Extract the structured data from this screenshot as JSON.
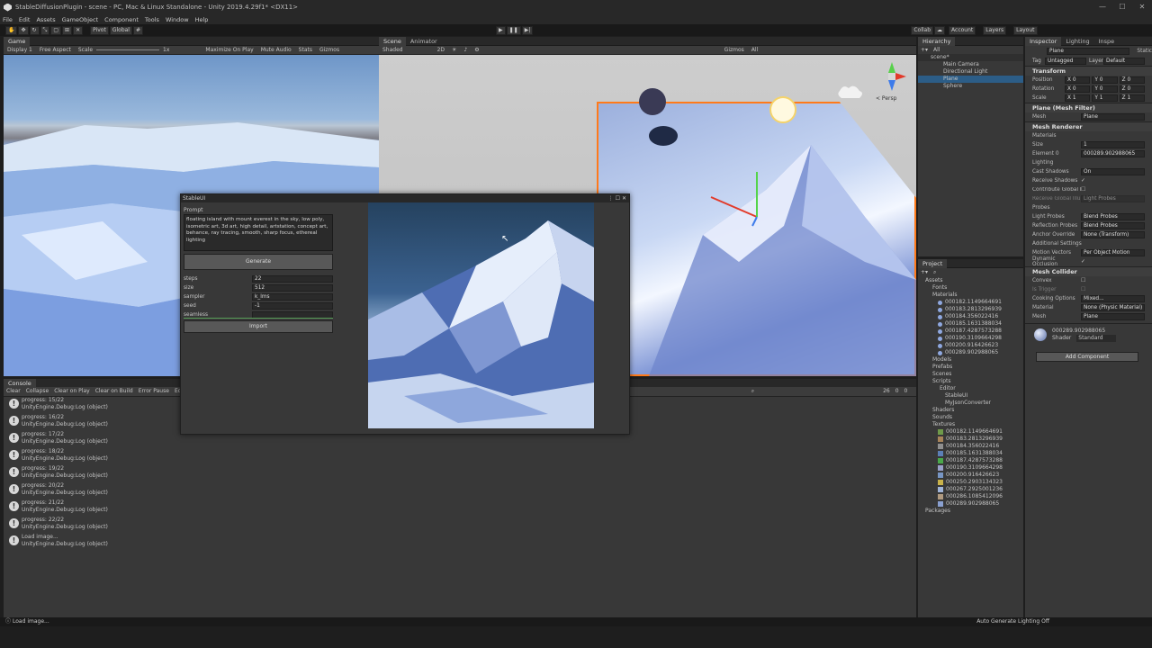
{
  "window": {
    "title": "StableDiffusionPlugin - scene - PC, Mac & Linux Standalone - Unity 2019.4.29f1* <DX11>"
  },
  "menu": [
    "File",
    "Edit",
    "Assets",
    "GameObject",
    "Component",
    "Tools",
    "Window",
    "Help"
  ],
  "toolbar": {
    "pivot": "Pivot",
    "global": "Global",
    "collab": "Collab",
    "account": "Account",
    "layers": "Layers",
    "layout": "Layout"
  },
  "game": {
    "tab": "Game",
    "display": "Display 1",
    "aspect": "Free Aspect",
    "scale_label": "Scale",
    "scale_value": "1x",
    "maximize": "Maximize On Play",
    "mute": "Mute Audio",
    "stats": "Stats",
    "gizmos": "Gizmos"
  },
  "scene": {
    "tab": "Scene",
    "tab2": "Animator",
    "shading": "Shaded",
    "mode2d": "2D",
    "gizmos": "Gizmos",
    "search": "All",
    "persp": "< Persp"
  },
  "console": {
    "tab": "Console",
    "buttons": [
      "Clear",
      "Collapse",
      "Clear on Play",
      "Clear on Build",
      "Error Pause",
      "Editor"
    ],
    "counts": [
      "26",
      "0",
      "0"
    ],
    "logs": [
      {
        "line1": "progress: 15/22",
        "line2": "UnityEngine.Debug:Log (object)"
      },
      {
        "line1": "progress: 16/22",
        "line2": "UnityEngine.Debug:Log (object)"
      },
      {
        "line1": "progress: 17/22",
        "line2": "UnityEngine.Debug:Log (object)"
      },
      {
        "line1": "progress: 18/22",
        "line2": "UnityEngine.Debug:Log (object)"
      },
      {
        "line1": "progress: 19/22",
        "line2": "UnityEngine.Debug:Log (object)"
      },
      {
        "line1": "progress: 20/22",
        "line2": "UnityEngine.Debug:Log (object)"
      },
      {
        "line1": "progress: 21/22",
        "line2": "UnityEngine.Debug:Log (object)"
      },
      {
        "line1": "progress: 22/22",
        "line2": "UnityEngine.Debug:Log (object)"
      },
      {
        "line1": "Load image...",
        "line2": "UnityEngine.Debug:Log (object)"
      }
    ]
  },
  "stableui": {
    "title": "StableUI",
    "prompt_label": "Prompt",
    "prompt_text": "floating island with mount everest in the sky, low poly, isometric art, 3d art, high detail, artstation, concept art, behance, ray tracing, smooth, sharp focus, ethereal lighting",
    "generate": "Generate",
    "fields": [
      {
        "label": "steps",
        "value": "22"
      },
      {
        "label": "size",
        "value": "512"
      },
      {
        "label": "sampler",
        "value": "k_lms"
      },
      {
        "label": "seed",
        "value": "-1"
      },
      {
        "label": "seamless",
        "value": ""
      }
    ],
    "import": "Import"
  },
  "hierarchy": {
    "tab": "Hierarchy",
    "search": "All",
    "root": "scene*",
    "items": [
      "Main Camera",
      "Directional Light",
      "Plane",
      "Sphere"
    ]
  },
  "project": {
    "tab": "Project",
    "assets": "Assets",
    "fonts": "Fonts",
    "materials": "Materials",
    "material_items": [
      "000182.1149664691",
      "000183.2813296939",
      "000184.356022416",
      "000185.1631388034",
      "000187.4287573288",
      "000190.3109664298",
      "000200.916426623",
      "000289.902988065"
    ],
    "folders": [
      "Models",
      "Prefabs",
      "Scenes",
      "Scripts"
    ],
    "editor": "Editor",
    "stableui": "StableUI",
    "jsonconv": "MyJsonConverter",
    "folders2": [
      "Shaders",
      "Sounds",
      "Textures"
    ],
    "texture_items": [
      "000182.1149664691",
      "000183.2813296939",
      "000184.356022416",
      "000185.1631388034",
      "000187.4287573288",
      "000190.3109664298",
      "000200.916426623",
      "000250.2903134323",
      "000267.2925001236",
      "000286.1085412096",
      "000289.902988065"
    ],
    "packages": "Packages"
  },
  "inspector": {
    "tabs": [
      "Inspector",
      "Lighting",
      "Inspe"
    ],
    "object": "Plane",
    "static": "Static",
    "tag_label": "Tag",
    "tag": "Untagged",
    "layer_label": "Layer",
    "layer": "Default",
    "transform": "Transform",
    "position": "Position",
    "rotation": "Rotation",
    "scale": "Scale",
    "pos": [
      "X 0",
      "Y 0",
      "Z 0"
    ],
    "rot": [
      "X 0",
      "Y 0",
      "Z 0"
    ],
    "scl": [
      "X 1",
      "Y 1",
      "Z 1"
    ],
    "mesh_filter": "Plane (Mesh Filter)",
    "mesh_label": "Mesh",
    "mesh_value": "Plane",
    "mesh_renderer": "Mesh Renderer",
    "materials": "Materials",
    "size_label": "Size",
    "size_value": "1",
    "element_label": "Element 0",
    "element_value": "000289.902988065",
    "lighting": "Lighting",
    "cast_shadows": "Cast Shadows",
    "cast_value": "On",
    "receive_shadows": "Receive Shadows",
    "contribute_gi": "Contribute Global Illumination",
    "receive_gi": "Receive Global Illumination",
    "receive_gi_value": "Light Probes",
    "probes": "Probes",
    "light_probes": "Light Probes",
    "light_probes_value": "Blend Probes",
    "refl_probes": "Reflection Probes",
    "refl_value": "Blend Probes",
    "anchor": "Anchor Override",
    "anchor_value": "None (Transform)",
    "additional": "Additional Settings",
    "motion": "Motion Vectors",
    "motion_value": "Per Object Motion",
    "dynamic_occ": "Dynamic Occlusion",
    "mesh_collider": "Mesh Collider",
    "convex": "Convex",
    "is_trigger": "Is Trigger",
    "cooking": "Cooking Options",
    "cooking_value": "Mixed...",
    "material_label": "Material",
    "material_value": "None (Physic Material)",
    "collider_mesh": "Mesh",
    "collider_mesh_value": "Plane",
    "mat_name": "000289.902988065",
    "shader_label": "Shader",
    "shader_value": "Standard",
    "add_component": "Add Component"
  },
  "status": {
    "left": "Load image...",
    "right": "Auto Generate Lighting Off"
  }
}
